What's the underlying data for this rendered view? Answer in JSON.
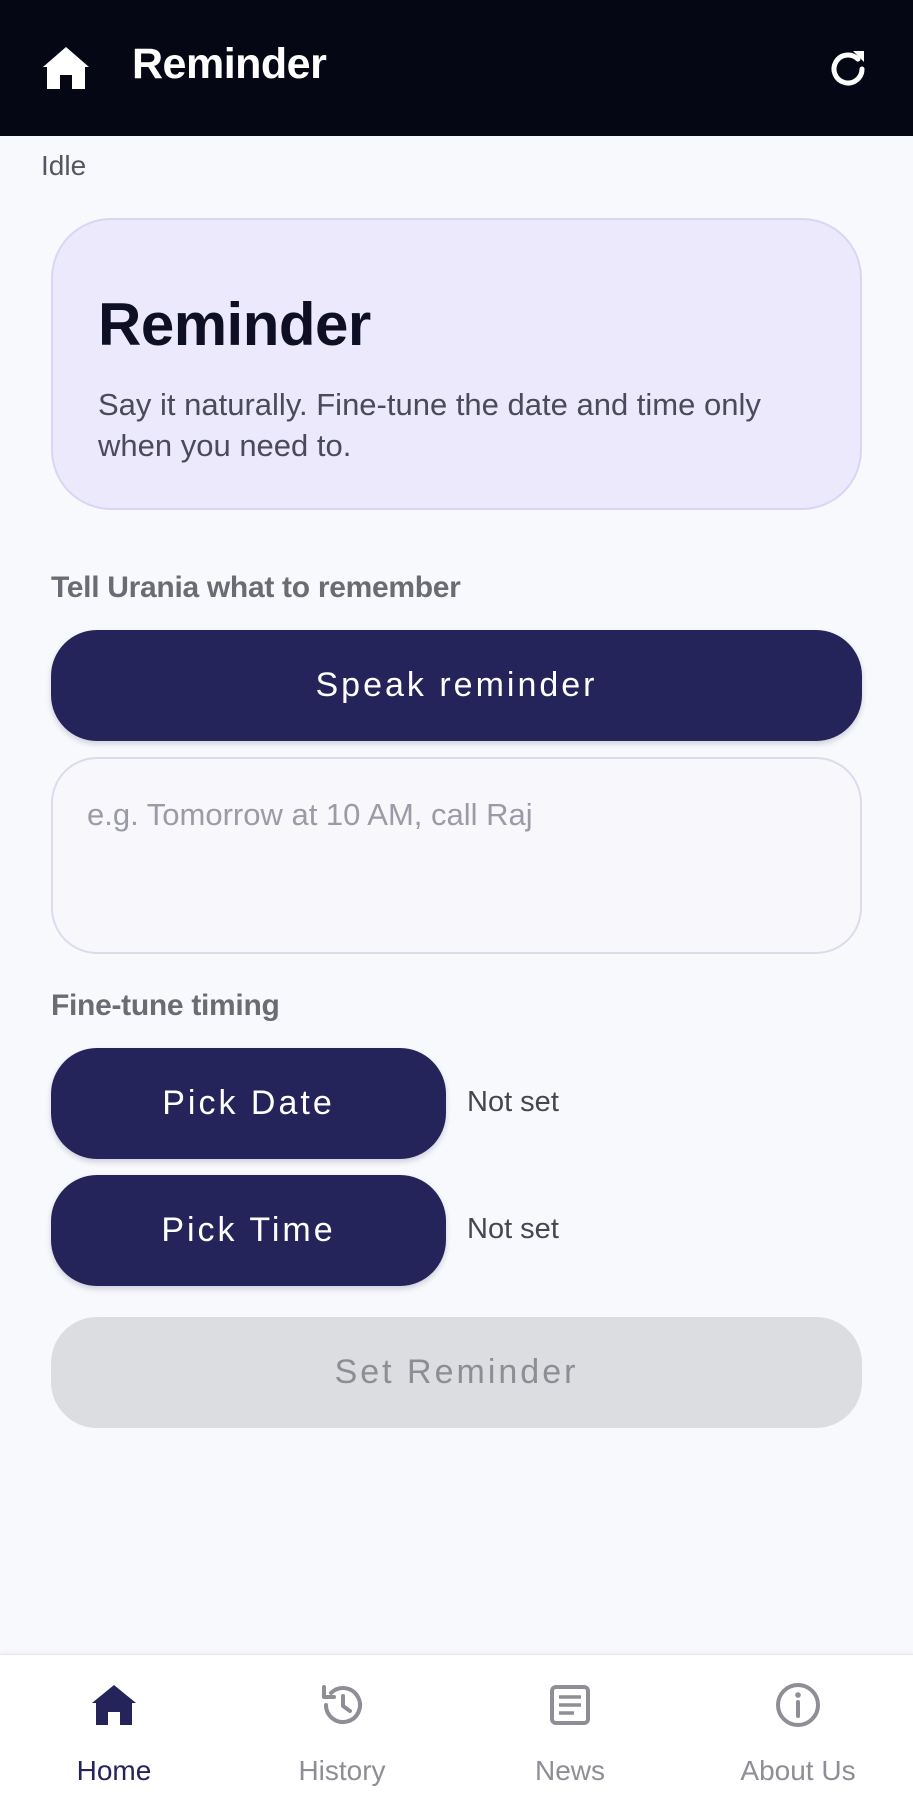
{
  "appbar": {
    "title": "Reminder",
    "home_icon": "home-icon",
    "refresh_icon": "refresh-icon"
  },
  "status": "Idle",
  "hero": {
    "title": "Reminder",
    "subtitle": "Say it naturally. Fine-tune the date and time only when you need to."
  },
  "speak_section": {
    "label": "Tell Urania what to remember",
    "speak_button": "Speak reminder",
    "input_placeholder": "e.g. Tomorrow at 10 AM, call Raj",
    "input_value": ""
  },
  "timing_section": {
    "label": "Fine-tune timing",
    "pick_date_button": "Pick Date",
    "date_value": "Not set",
    "pick_time_button": "Pick Time",
    "time_value": "Not set"
  },
  "set_reminder_button": "Set Reminder",
  "colors": {
    "primary": "#25245a",
    "appbar": "#050814",
    "hero_bg": "#ebe9fb",
    "disabled": "#dcdde0"
  },
  "bottom_nav": {
    "items": [
      {
        "label": "Home",
        "icon": "home-icon",
        "active": true
      },
      {
        "label": "History",
        "icon": "history-icon",
        "active": false
      },
      {
        "label": "News",
        "icon": "news-icon",
        "active": false
      },
      {
        "label": "About Us",
        "icon": "info-icon",
        "active": false
      }
    ]
  }
}
